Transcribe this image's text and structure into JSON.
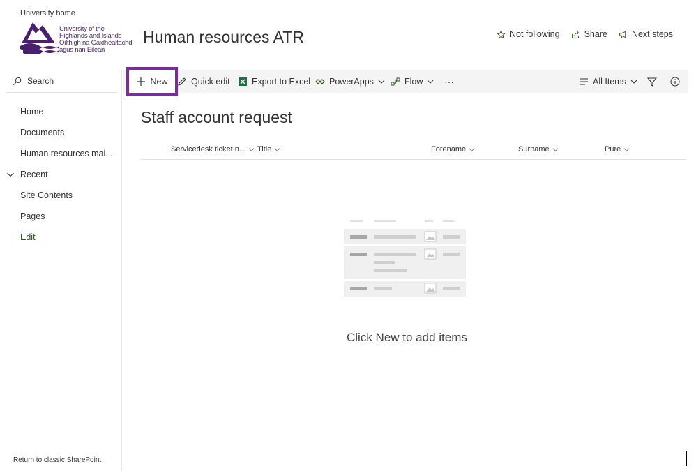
{
  "header": {
    "university_home": "University home",
    "logo_lines": [
      "University of the",
      "Highlands and Islands",
      "Oilthigh na Gàidhealtachd",
      "agus nan Eilean"
    ],
    "site_title": "Human resources ATR",
    "actions": {
      "follow": "Not following",
      "share": "Share",
      "next_steps": "Next steps"
    }
  },
  "left_nav": {
    "search_placeholder": "Search",
    "items": [
      "Home",
      "Documents",
      "Human resources mai...",
      "Recent",
      "Site Contents",
      "Pages",
      "Edit"
    ],
    "return_classic": "Return to classic SharePoint"
  },
  "command_bar": {
    "new": "New",
    "quick_edit": "Quick edit",
    "export": "Export to Excel",
    "powerapps": "PowerApps",
    "flow": "Flow",
    "more": "···",
    "view": "All Items"
  },
  "list": {
    "title": "Staff account request",
    "columns": [
      "Servicedesk ticket n...",
      "Title",
      "Forename",
      "Surname",
      "Pure"
    ],
    "empty_message": "Click New to add items"
  },
  "colors": {
    "accent_purple": "#7c2b9e",
    "logo_purple": "#4b1f6f",
    "edit_green": "#31571f",
    "excel_green": "#1e7145"
  }
}
